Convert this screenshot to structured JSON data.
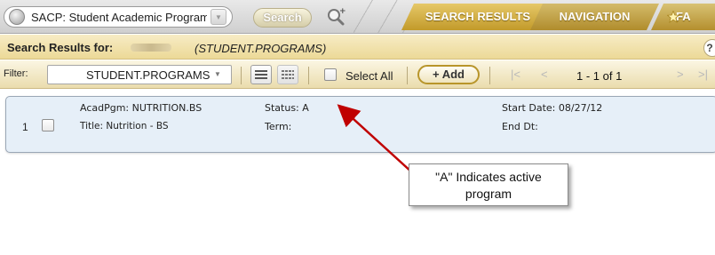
{
  "top_bar": {
    "search_value": "SACP: Student Academic Program",
    "search_button": "Search",
    "tabs": {
      "search_results": "SEARCH RESULTS",
      "navigation": "NAVIGATION",
      "favorites": "FA"
    }
  },
  "title_row": {
    "label": "Search Results for:",
    "file": "(STUDENT.PROGRAMS)"
  },
  "toolbar": {
    "filter_label": "Filter:",
    "filter_value": "STUDENT.PROGRAMS",
    "select_all_label": "Select All",
    "add_label": "+ Add",
    "page_range": "1 - 1 of 1"
  },
  "result": {
    "row_number": "1",
    "acad_pgm": "AcadPgm: NUTRITION.BS",
    "title": "Title: Nutrition - BS",
    "status": "Status: A",
    "term": "Term:",
    "start_date": "Start Date: 08/27/12",
    "end_date": "End Dt:"
  },
  "annotation": {
    "line1": "\"A\" Indicates active",
    "line2": "program"
  },
  "colors": {
    "tab_gold": "#c29a2a",
    "card_bg": "#e6eff8",
    "arrow_red": "#c00000"
  }
}
